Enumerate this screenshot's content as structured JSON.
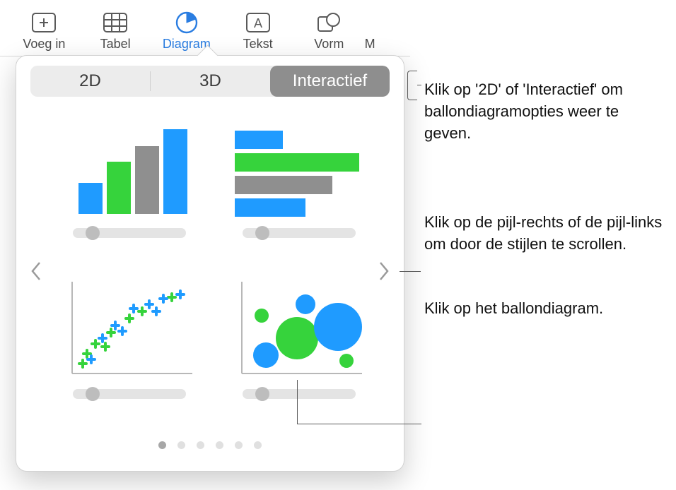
{
  "toolbar": {
    "items": [
      {
        "label": "Voeg in",
        "icon": "insert-icon"
      },
      {
        "label": "Tabel",
        "icon": "table-icon"
      },
      {
        "label": "Diagram",
        "icon": "chart-icon"
      },
      {
        "label": "Tekst",
        "icon": "text-icon"
      },
      {
        "label": "Vorm",
        "icon": "shape-icon"
      },
      {
        "label": "M",
        "icon": "media-icon"
      }
    ],
    "active_index": 2
  },
  "segmented": {
    "tabs": [
      "2D",
      "3D",
      "Interactief"
    ],
    "selected_index": 2
  },
  "chart_styles": {
    "items": [
      {
        "name": "bar-chart-interactive"
      },
      {
        "name": "horizontal-bar-chart-interactive"
      },
      {
        "name": "scatter-chart-interactive"
      },
      {
        "name": "bubble-chart-interactive"
      }
    ]
  },
  "pager": {
    "count": 6,
    "current": 0
  },
  "callouts": {
    "tabs": "Klik op '2D' of 'Interactief' om ballondiagramopties weer te geven.",
    "arrows": "Klik op de pijl-rechts of de pijl-links om door de stijlen te scrollen.",
    "bubble": "Klik op het ballondiagram."
  },
  "colors": {
    "blue": "#1f9bff",
    "green": "#36d33c",
    "gray": "#8f8f8f"
  }
}
